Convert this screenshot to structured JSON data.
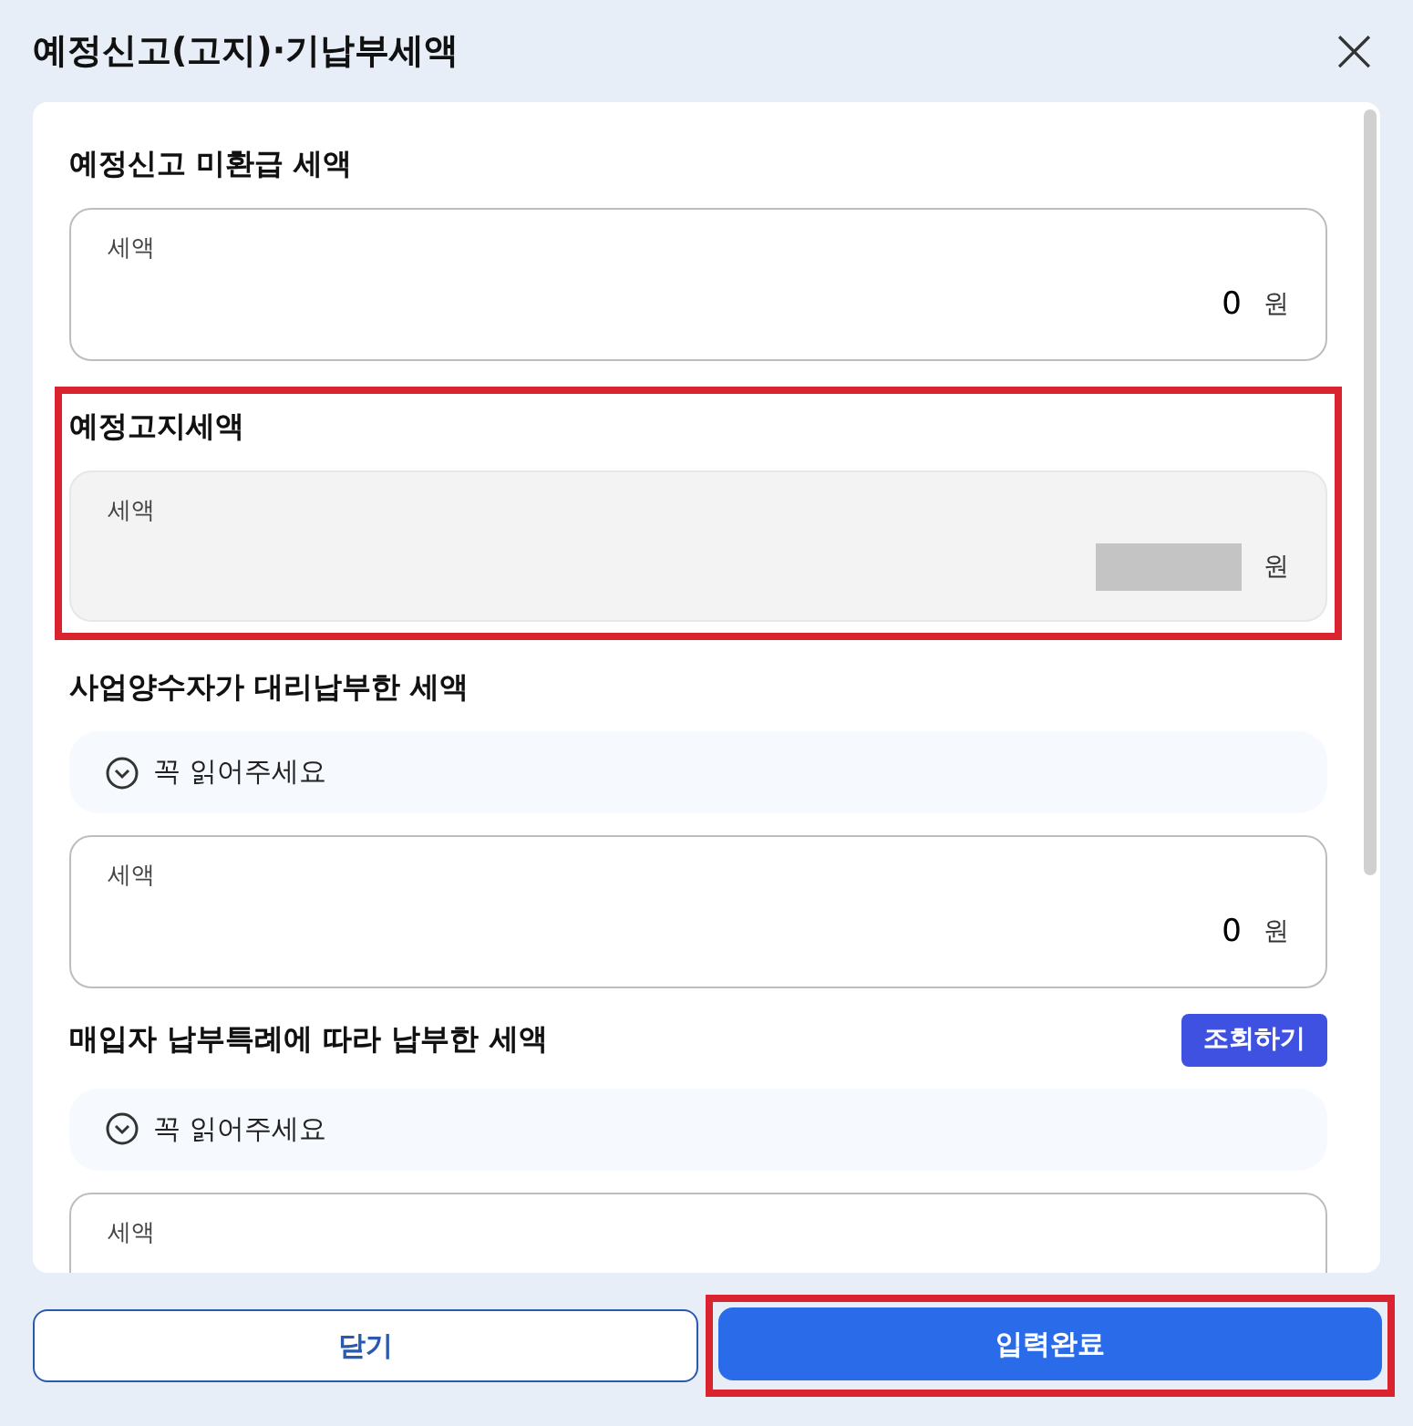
{
  "dialog": {
    "title": "예정신고(고지)·기납부세액",
    "close": "×"
  },
  "sections": [
    {
      "title": "예정신고 미환급 세액",
      "highlighted": false,
      "field": {
        "label": "세액",
        "value": "0",
        "unit": "원",
        "disabled": false,
        "redacted": false
      }
    },
    {
      "title": "예정고지세액",
      "highlighted": true,
      "field": {
        "label": "세액",
        "unit": "원",
        "disabled": true,
        "redacted": true
      }
    },
    {
      "title": "사업양수자가 대리납부한 세액",
      "highlighted": false,
      "notice": "꼭 읽어주세요",
      "field": {
        "label": "세액",
        "value": "0",
        "unit": "원",
        "disabled": false,
        "redacted": false
      }
    },
    {
      "title": "매입자 납부특례에 따라 납부한 세액",
      "highlighted": false,
      "button": "조회하기",
      "notice": "꼭 읽어주세요",
      "field": {
        "label": "세액",
        "disabled": false,
        "redacted": false
      }
    }
  ],
  "footer": [
    {
      "label": "닫기",
      "kind": "secondary",
      "highlighted": false
    },
    {
      "label": "입력완료",
      "kind": "primary",
      "highlighted": true
    }
  ]
}
